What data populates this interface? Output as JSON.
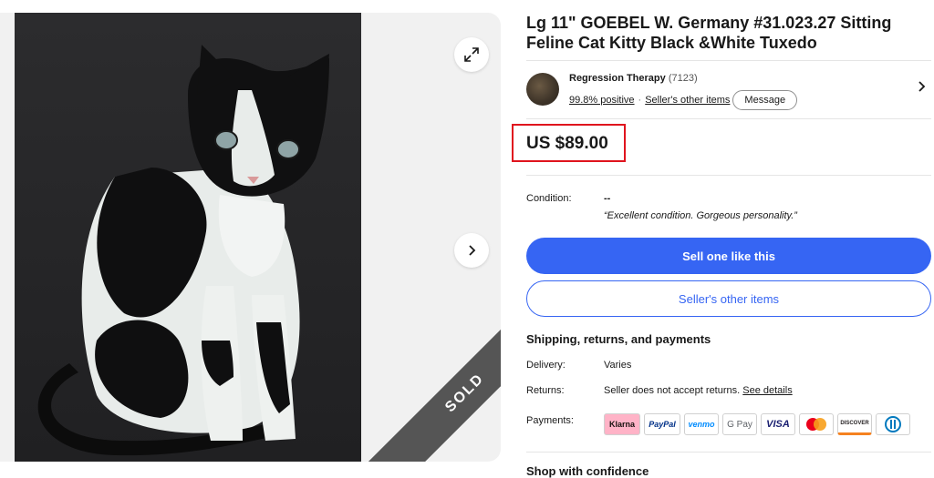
{
  "listing": {
    "title": "Lg 11\" GOEBEL W. Germany #31.023.27 Sitting Feline Cat Kitty Black &White Tuxedo",
    "sold_label": "SOLD"
  },
  "seller": {
    "name": "Regression Therapy",
    "feedback_count": "(7123)",
    "positive": "99.8% positive",
    "separator": "·",
    "other_items": "Seller's other items",
    "message_label": "Message"
  },
  "price": "US $89.00",
  "condition": {
    "label": "Condition:",
    "value": "--",
    "quote": "“Excellent condition. Gorgeous personality.”"
  },
  "buttons": {
    "sell_one": "Sell one like this",
    "sellers_other": "Seller's other items"
  },
  "shipping": {
    "heading": "Shipping, returns, and payments",
    "delivery_label": "Delivery:",
    "delivery_value": "Varies",
    "returns_label": "Returns:",
    "returns_value": "Seller does not accept returns.",
    "returns_link": "See details",
    "payments_label": "Payments:"
  },
  "payments": [
    {
      "name": "Klarna",
      "icon": "klarna-icon",
      "bg": "#ffb3c7",
      "fg": "#17120f"
    },
    {
      "name": "PayPal",
      "icon": "paypal-icon",
      "bg": "#ffffff",
      "fg": "#003087"
    },
    {
      "name": "venmo",
      "icon": "venmo-icon",
      "bg": "#ffffff",
      "fg": "#008cff"
    },
    {
      "name": "G Pay",
      "icon": "google-pay-icon",
      "bg": "#ffffff",
      "fg": "#5f6368"
    },
    {
      "name": "VISA",
      "icon": "visa-icon",
      "bg": "#ffffff",
      "fg": "#1a1f71"
    },
    {
      "name": "",
      "icon": "mastercard-icon",
      "bg": "#ffffff",
      "fg": "#000000"
    },
    {
      "name": "DISCOVER",
      "icon": "discover-icon",
      "bg": "#ffffff",
      "fg": "#231f20"
    },
    {
      "name": "",
      "icon": "diners-club-icon",
      "bg": "#ffffff",
      "fg": "#0079be"
    }
  ],
  "shop_confidence": "Shop with confidence",
  "colors": {
    "accent": "#3665f3",
    "price_highlight": "#e0141e",
    "sold_ribbon": "#555555"
  }
}
